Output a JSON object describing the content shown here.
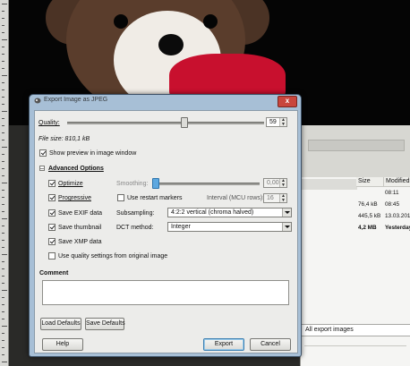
{
  "dialog": {
    "title": "Export Image as JPEG",
    "close_label": "x",
    "quality": {
      "label": "Quality:",
      "value": "59",
      "fraction": 0.59
    },
    "file_size": "File size: 810,1 kB",
    "show_preview": {
      "label": "Show preview in image window",
      "checked": true
    },
    "advanced": {
      "label": "Advanced Options",
      "expanded": true,
      "optimize": {
        "label": "Optimize",
        "checked": true
      },
      "progressive": {
        "label": "Progressive",
        "checked": true
      },
      "save_exif": {
        "label": "Save EXIF data",
        "checked": true
      },
      "save_thumbnail": {
        "label": "Save thumbnail",
        "checked": true
      },
      "save_xmp": {
        "label": "Save XMP data",
        "checked": true
      },
      "use_quality_original": {
        "label": "Use quality settings from original image",
        "checked": false
      },
      "smoothing": {
        "label": "Smoothing:",
        "value": "0,00",
        "fraction": 0.0
      },
      "restart_markers": {
        "label": "Use restart markers",
        "checked": false
      },
      "interval": {
        "label": "Interval (MCU rows):",
        "value": "16"
      },
      "subsampling": {
        "label": "Subsampling:",
        "value": "4:2:2 vertical (chroma halved)"
      },
      "dct": {
        "label": "DCT method:",
        "value": "Integer"
      }
    },
    "comment": {
      "label": "Comment",
      "value": ""
    },
    "buttons": {
      "load_defaults": "Load Defaults",
      "save_defaults": "Save Defaults",
      "help": "Help",
      "export": "Export",
      "cancel": "Cancel"
    }
  },
  "file_chooser": {
    "columns": {
      "size": "Size",
      "modified": "Modified"
    },
    "rows": [
      {
        "size": "",
        "modified": "08:11"
      },
      {
        "size": "76,4 kB",
        "modified": "08:45"
      },
      {
        "size": "445,5 kB",
        "modified": "13.03.201"
      },
      {
        "size": "4,2 MB",
        "modified": "Yesterday"
      }
    ],
    "filter": "All export images"
  },
  "colors": {
    "titlebar": "#a7bfd6",
    "close": "#c9463d",
    "scarf": "#c8102e"
  }
}
